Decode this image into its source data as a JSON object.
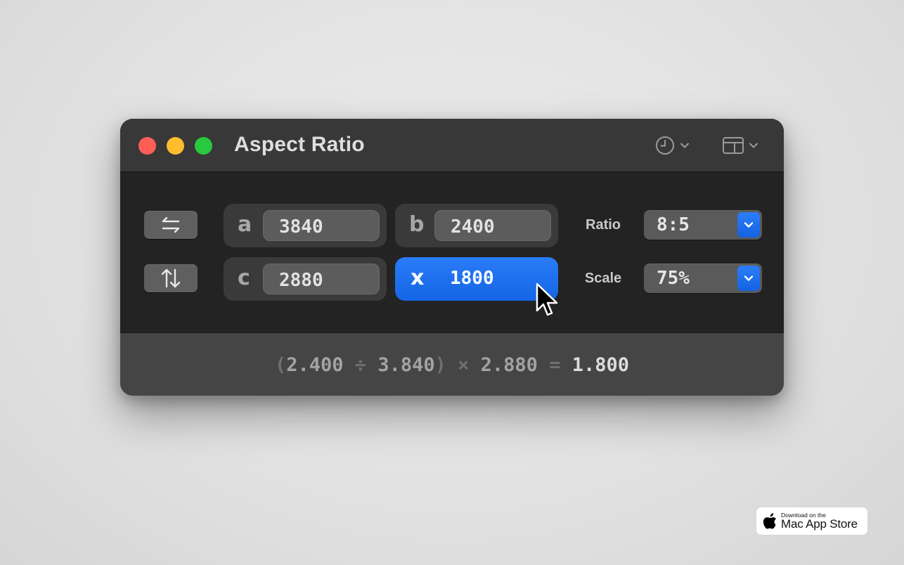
{
  "window": {
    "title": "Aspect Ratio",
    "toolbar": {
      "history_icon": "clock-icon",
      "layout_icon": "sidebar-layout-icon"
    }
  },
  "fields": {
    "a": {
      "letter": "a",
      "value": "3840"
    },
    "b": {
      "letter": "b",
      "value": "2400"
    },
    "c": {
      "letter": "c",
      "value": "2880"
    },
    "x": {
      "letter": "x",
      "value": "1800",
      "active": true
    }
  },
  "controls": {
    "swap_horizontal_icon": "swap-horizontal-icon",
    "swap_vertical_icon": "swap-vertical-icon",
    "ratio": {
      "label": "Ratio",
      "value": "8:5"
    },
    "scale": {
      "label": "Scale",
      "value": "75%"
    }
  },
  "formula": {
    "open_paren": "(",
    "b": "2.400",
    "divide": "÷",
    "a": "3.840",
    "close_paren": ")",
    "times": "×",
    "c": "2.880",
    "equals": "=",
    "result": "1.800"
  },
  "badge": {
    "small_text": "Download on the",
    "big_text": "Mac App Store"
  },
  "colors": {
    "accent": "#1d6ef0",
    "window_bg": "#232323",
    "titlebar_bg": "#383838",
    "footer_bg": "#454545",
    "close": "#fd5f57",
    "minimize": "#febc2e",
    "zoom": "#28c840"
  }
}
